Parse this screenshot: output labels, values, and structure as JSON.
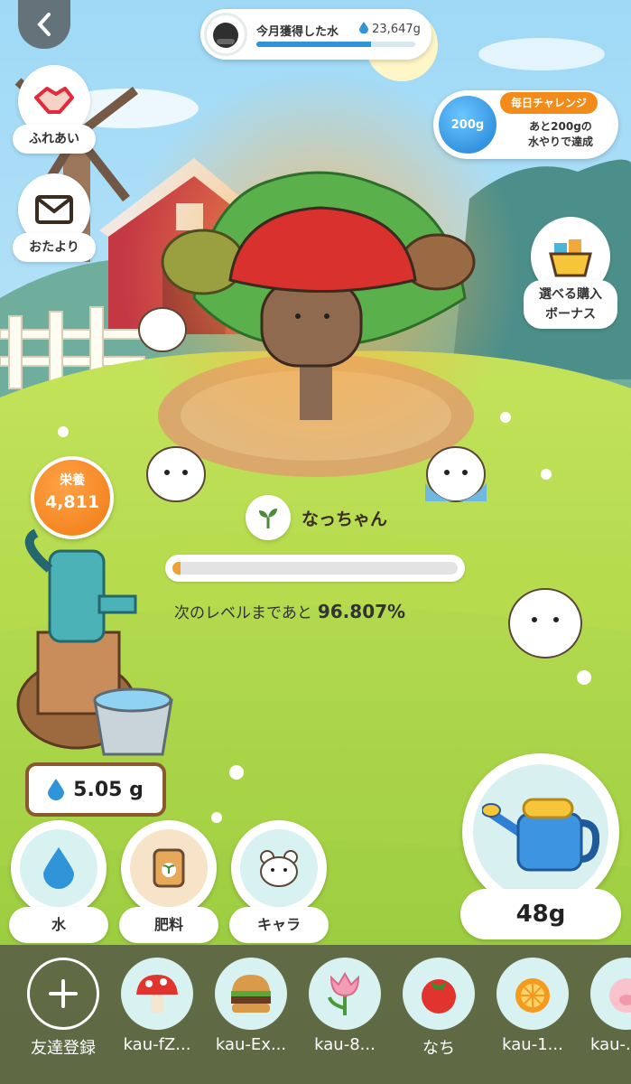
{
  "header": {
    "water_label": "今月獲得した水",
    "water_value": "23,647g",
    "water_progress": 0.72
  },
  "side_buttons": {
    "fureai": "ふれあい",
    "otayori": "おたより"
  },
  "challenge": {
    "jar_amount": "200g",
    "tag": "毎日チャレンジ",
    "desc": "あと200gの\n水やりで達成"
  },
  "bonus": {
    "label": "選べる購入\nボーナス"
  },
  "nutrition": {
    "title": "栄養",
    "value": "4,811"
  },
  "plant": {
    "name": "なっちゃん",
    "level_text": "次のレベルまであと",
    "level_pct": "96.807%",
    "level_progress": 0.03
  },
  "water_amount": "5.05 g",
  "actions": [
    {
      "label": "水",
      "icon": "water-drop-icon"
    },
    {
      "label": "肥料",
      "icon": "fertilizer-icon"
    },
    {
      "label": "キャラ",
      "icon": "hamster-icon"
    }
  ],
  "watering_can": {
    "amount": "48g"
  },
  "friends": [
    {
      "name": "友達登録",
      "icon": "plus-icon"
    },
    {
      "name": "kau-fZ...",
      "icon": "mushroom-icon"
    },
    {
      "name": "kau-Ex...",
      "icon": "burger-icon"
    },
    {
      "name": "kau-8...",
      "icon": "tulip-icon"
    },
    {
      "name": "なち",
      "icon": "tomato-icon"
    },
    {
      "name": "kau-1...",
      "icon": "orange-icon"
    },
    {
      "name": "kau-...",
      "icon": "pig-icon"
    }
  ],
  "colors": {
    "accent_orange": "#f07a12",
    "water_blue": "#2f95d8",
    "grass": "#a9d84a",
    "sky": "#bfe7fb"
  }
}
